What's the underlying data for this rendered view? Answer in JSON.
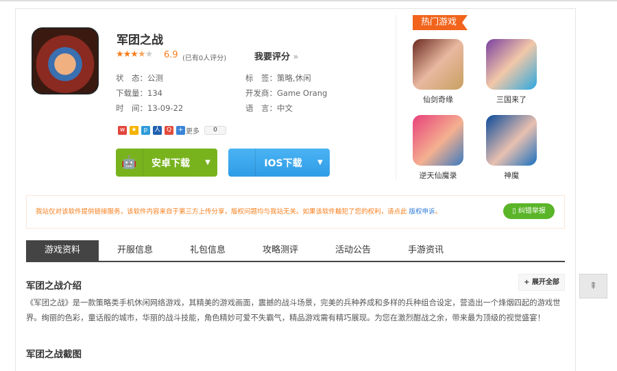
{
  "app": {
    "title": "军团之战",
    "score": "6.9",
    "rating_fraction": 0.69,
    "rating_count": "(已有0人评分)",
    "rate_label": "我要评分",
    "rate_arrow": "»"
  },
  "info": {
    "status_label": "状　态：",
    "status": "公测",
    "downloads_label": "下载量：",
    "downloads": "134",
    "time_label": "时　间：",
    "time": "13-09-22",
    "tags_label": "标　签：",
    "tags": "策略,休闲",
    "dev_label": "开发商：",
    "dev": "Game Orang",
    "lang_label": "语　言：",
    "lang": "中文"
  },
  "share": {
    "more": "更多",
    "count": "0"
  },
  "buttons": {
    "android": "安卓下载",
    "ios": "IOS下载"
  },
  "hot": {
    "title": "热门游戏",
    "games": [
      {
        "name": "仙剑奇缘"
      },
      {
        "name": "三国来了"
      },
      {
        "name": "逆天仙魔录"
      },
      {
        "name": "神魔"
      }
    ]
  },
  "notice": {
    "text": "我站仅对该软件提供链接服务，该软件内容来自于第三方上传分享，版权问题均与我站无关。如果该软件触犯了您的权利，请点此",
    "link": "版权申诉",
    "end": "。",
    "report": "纠错举报"
  },
  "tabs": [
    "游戏资料",
    "开服信息",
    "礼包信息",
    "攻略测评",
    "活动公告",
    "手游资讯"
  ],
  "intro": {
    "title": "军团之战介绍",
    "expand": "+ 展开全部",
    "text": "《军团之战》是一款策略类手机休闲网络游戏，其精美的游戏画面，震撼的战斗场景，完美的兵种养成和多样的兵种组合设定，营造出一个烽烟四起的游戏世界。绚丽的色彩，童话般的城市，华丽的战斗技能，角色精妙可爱不失霸气，精品游戏需有精巧展现。为您在激烈酣战之余，带来最为顶级的视觉盛宴！"
  },
  "screens": {
    "title": "军团之战截图"
  },
  "totop": "⇞"
}
